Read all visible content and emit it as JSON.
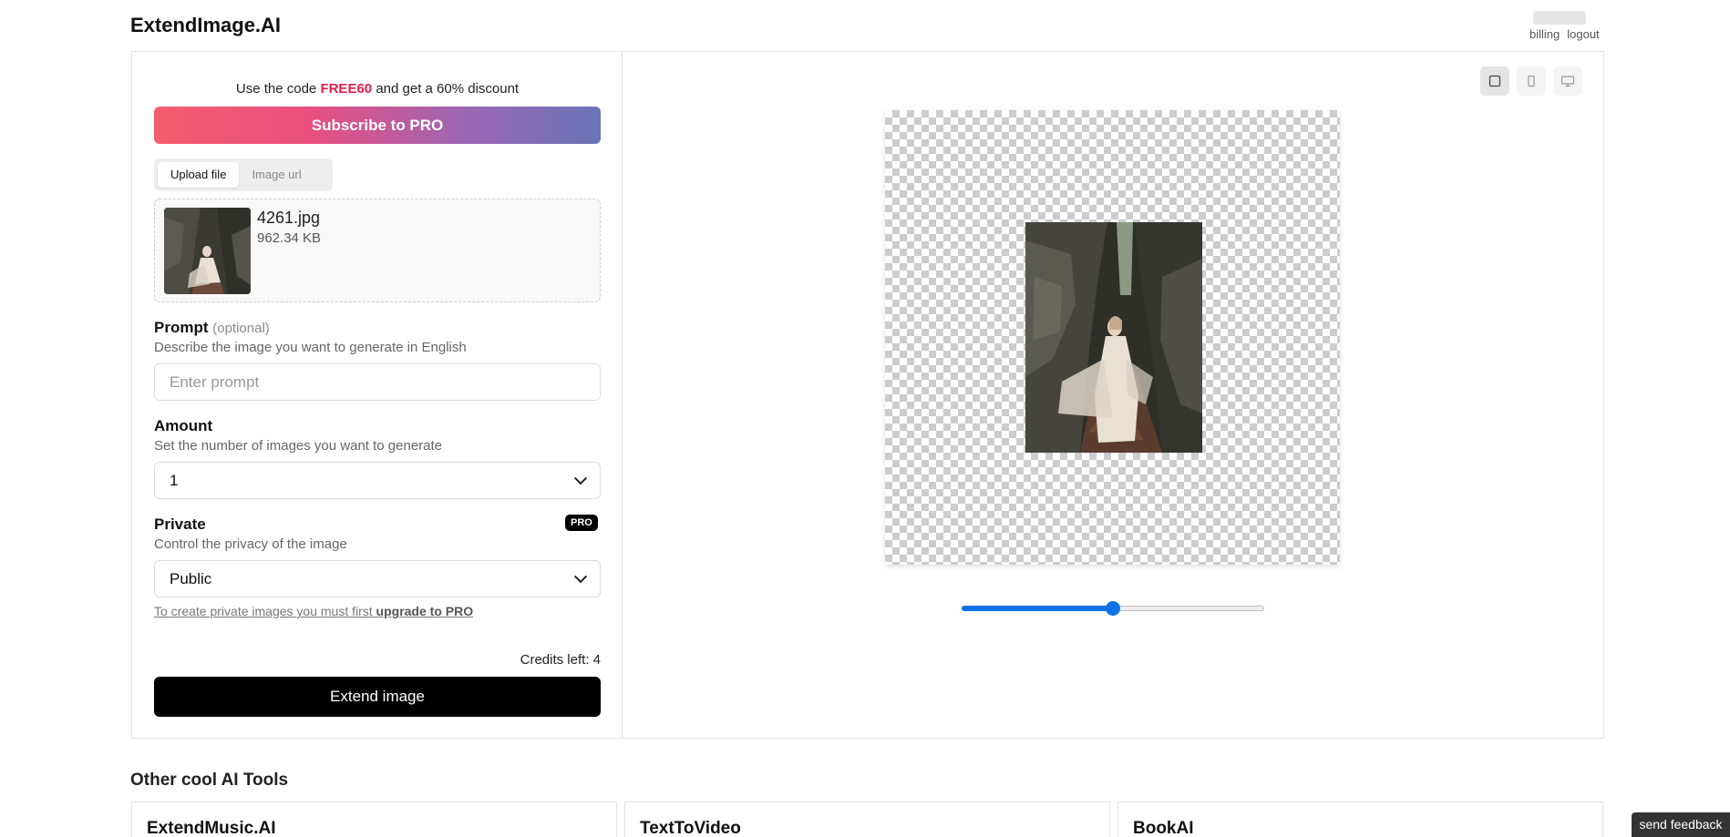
{
  "header": {
    "logo": "ExtendImage.AI",
    "billing_label": "billing",
    "logout_label": "logout"
  },
  "promo": {
    "prefix": "Use the code",
    "code": "FREE60",
    "suffix": "and get a 60% discount",
    "code_color": "#e11d48"
  },
  "subscribe_label": "Subscribe to PRO",
  "upload_tabs": [
    {
      "label": "Upload file",
      "active": true
    },
    {
      "label": "Image url",
      "active": false
    }
  ],
  "file": {
    "name": "4261.jpg",
    "size": "962.34 KB"
  },
  "prompt": {
    "label": "Prompt",
    "optional": "(optional)",
    "help": "Describe the image you want to generate in English",
    "placeholder": "Enter prompt",
    "value": ""
  },
  "amount": {
    "label": "Amount",
    "help": "Set the number of images you want to generate",
    "selected": "1"
  },
  "privacy": {
    "label": "Private",
    "badge": "PRO",
    "help": "Control the privacy of the image",
    "selected": "Public",
    "note_prefix": "To create private images you must first",
    "note_link": "upgrade to PRO"
  },
  "credits": "Credits left: 4",
  "extend_label": "Extend image",
  "preview": {
    "view_modes": [
      "square-view-icon",
      "portrait-view-icon",
      "landscape-view-icon"
    ],
    "active_view": "square-view-icon",
    "zoom_fraction": 0.5,
    "slider_color": "#0b74e5"
  },
  "other_tools": {
    "title": "Other cool AI Tools",
    "items": [
      "ExtendMusic.AI",
      "TextToVideo",
      "BookAI"
    ]
  },
  "feedback_label": "send feedback"
}
